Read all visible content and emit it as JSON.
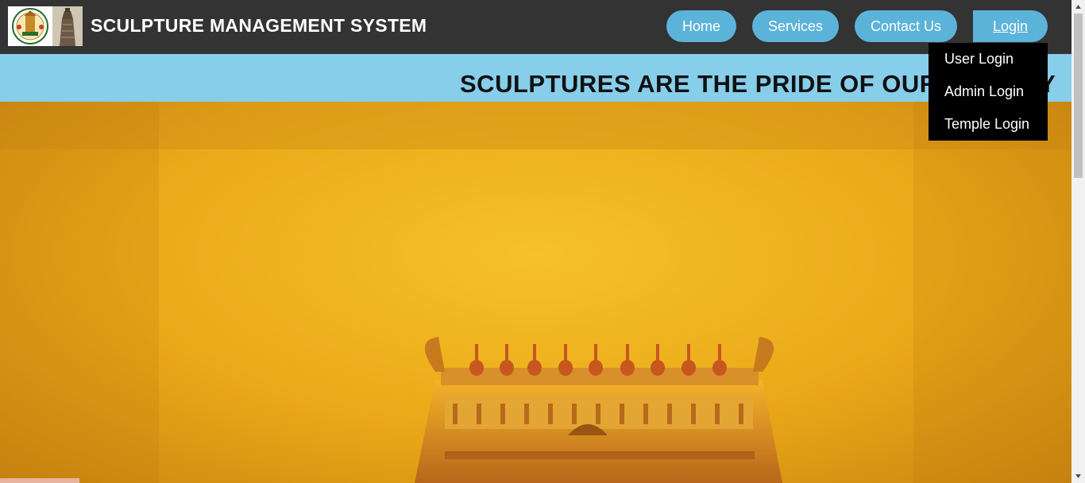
{
  "header": {
    "title": "SCULPTURE MANAGEMENT SYSTEM",
    "logo_left": "tamil-nadu-emblem",
    "logo_right": "temple-tower"
  },
  "nav": {
    "home": "Home",
    "services": "Services",
    "contact": "Contact Us",
    "login": "Login"
  },
  "login_menu": {
    "items": [
      "User Login",
      "Admin Login",
      "Temple Login"
    ]
  },
  "banner": {
    "text": "SCULPTURES ARE THE PRIDE OF OUR HISTORY"
  },
  "colors": {
    "header_bg": "#333333",
    "nav_button": "#5bb3d9",
    "banner_bg": "#87ceeb",
    "dropdown_bg": "#000000",
    "hero_gold": "#f2b91f"
  }
}
